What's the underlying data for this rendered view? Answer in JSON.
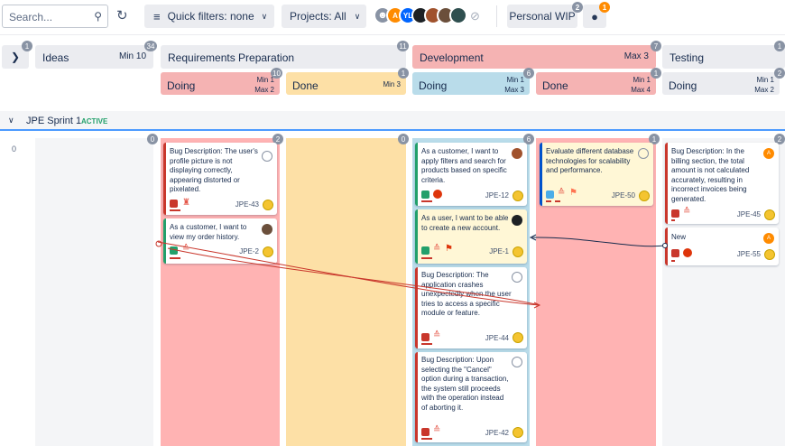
{
  "toolbar": {
    "search_placeholder": "Search...",
    "quick_filters": "Quick filters: none",
    "projects": "Projects: All",
    "personal_wip": "Personal WIP",
    "wip_badge": "2",
    "team_badge": "1",
    "avatar_a": "A",
    "avatar_yl": "YL"
  },
  "columns": {
    "ideas": {
      "name": "Ideas",
      "limit": "Min 10",
      "count": "1",
      "count2": "34"
    },
    "req": {
      "name": "Requirements Preparation",
      "count": "11"
    },
    "dev": {
      "name": "Development",
      "limit": "Max 3",
      "count": "7"
    },
    "test": {
      "name": "Testing",
      "count": "1"
    }
  },
  "subcolumns": {
    "req_doing": {
      "name": "Doing",
      "min": "Min 1",
      "max": "Max 2",
      "count": "10"
    },
    "req_done": {
      "name": "Done",
      "min": "Min 3",
      "count": "1"
    },
    "dev_doing": {
      "name": "Doing",
      "min": "Min 1",
      "max": "Max 3",
      "count": "6"
    },
    "dev_done": {
      "name": "Done",
      "min": "Min 1",
      "max": "Max 4",
      "count": "1"
    },
    "test_doing": {
      "name": "Doing",
      "min": "Min 1",
      "max": "Max 2",
      "count": "2"
    }
  },
  "sprint": {
    "name": "JPE Sprint 1",
    "status": "ACTIVE",
    "row_label": "0"
  },
  "lane_counts": [
    "0",
    "2",
    "0",
    "6",
    "1",
    "2"
  ],
  "cards": {
    "jpe43": {
      "text": "Bug Description: The user's profile picture is not displaying correctly, appearing distorted or pixelated.",
      "key": "JPE-43"
    },
    "jpe2": {
      "text": "As a customer, I want to view my order history.",
      "key": "JPE-2"
    },
    "jpe12": {
      "text": "As a customer, I want to apply filters and search for products based on specific criteria.",
      "key": "JPE-12"
    },
    "jpe1": {
      "text": "As a user, I want to be able to create a new account.",
      "key": "JPE-1"
    },
    "jpe44": {
      "text": "Bug Description: The application crashes unexpectedly when the user tries to access a specific module or feature.",
      "key": "JPE-44"
    },
    "jpe42": {
      "text": "Bug Description: Upon selecting the \"Cancel\" option during a transaction, the system still proceeds with the operation instead of aborting it.",
      "key": "JPE-42"
    },
    "jpe50": {
      "text": "Evaluate different database technologies for scalability and performance.",
      "key": "JPE-50"
    },
    "jpe45": {
      "text": "Bug Description: In the billing section, the total amount is not calculated accurately, resulting in incorrect invoices being generated.",
      "key": "JPE-45",
      "avatar": "A"
    },
    "jpe55": {
      "text": "New",
      "key": "JPE-55",
      "avatar": "A"
    }
  },
  "colors": {
    "red_lane": "#ffb3b3",
    "orange_lane": "#fde0a6",
    "blue_lane": "#b9dcea",
    "bug": "#c9372c",
    "story": "#22a06b",
    "accent": "#0052cc"
  }
}
